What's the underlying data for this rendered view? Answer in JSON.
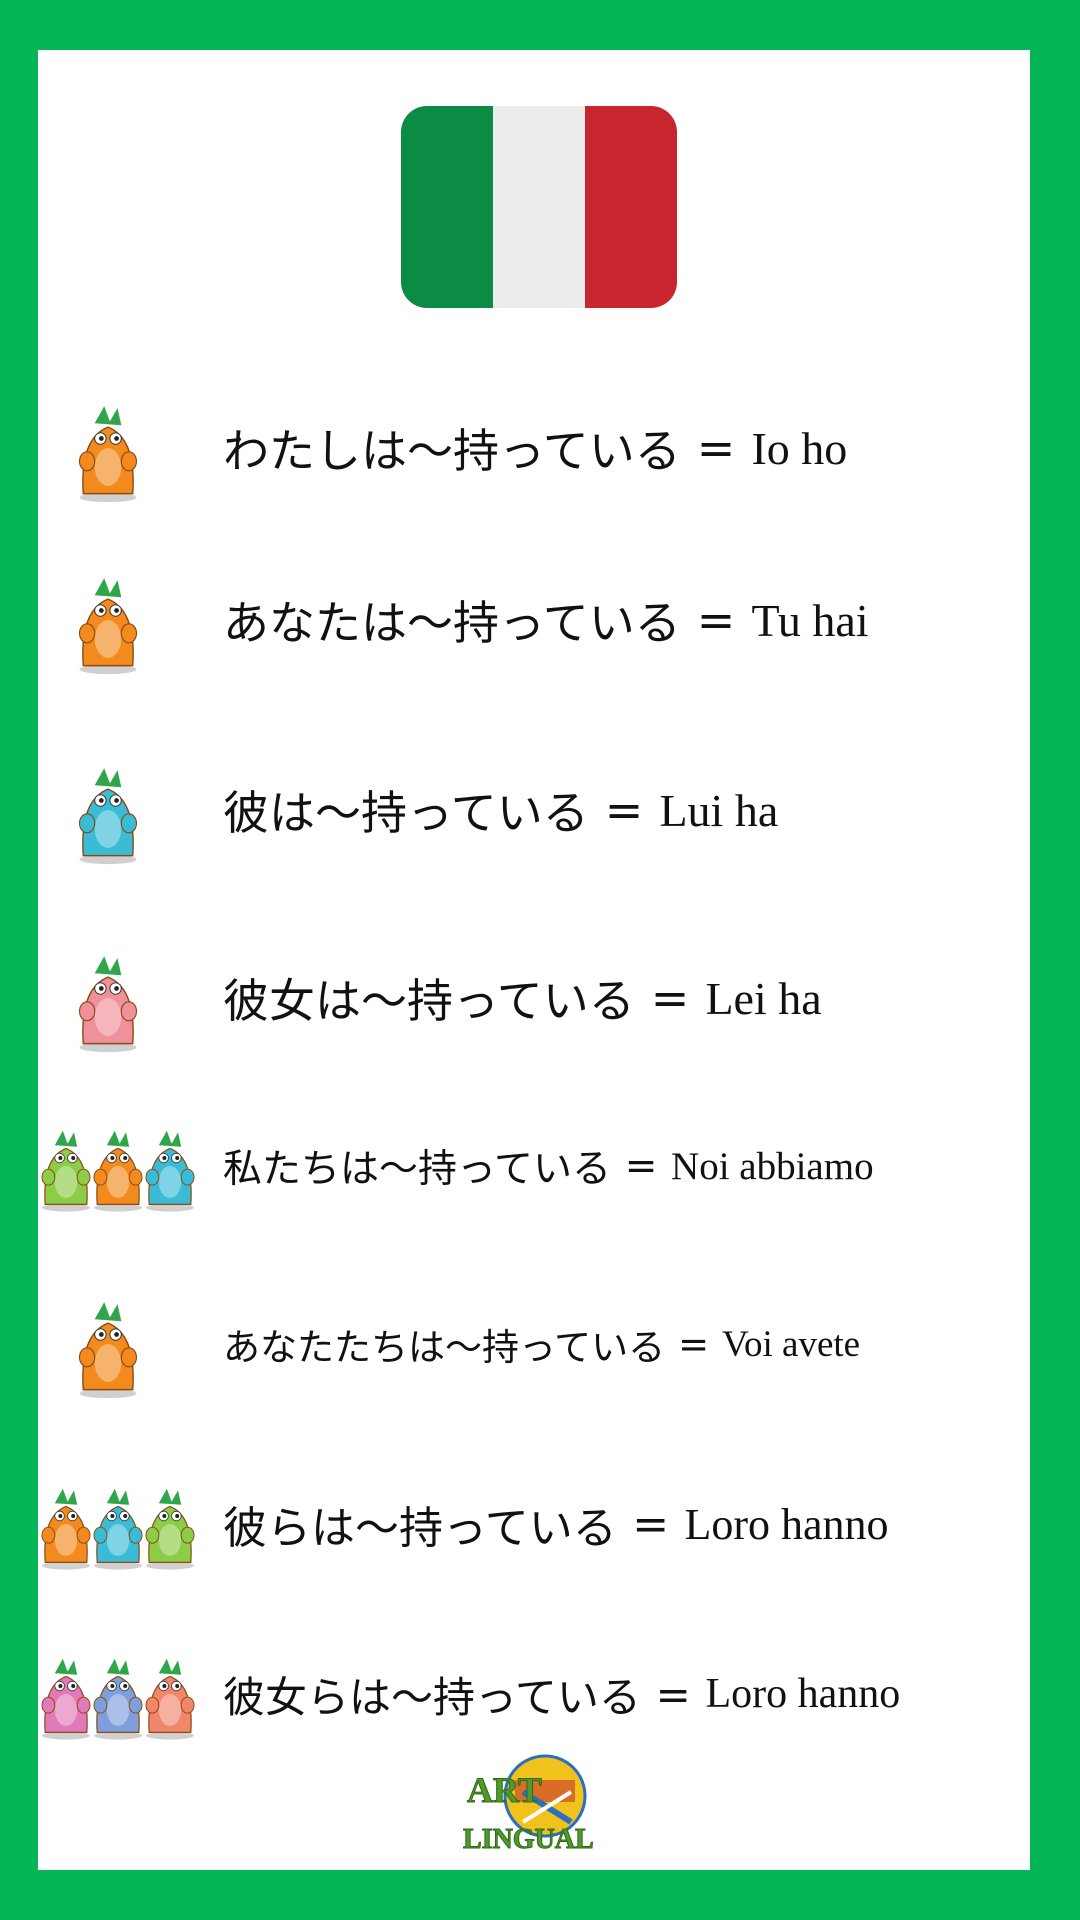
{
  "flag": {
    "name": "italy-flag",
    "colors": [
      "#0b8c44",
      "#ececec",
      "#c8262f"
    ]
  },
  "rows": [
    {
      "ja": "わたしは〜持っている",
      "eq": "=",
      "it": "Io ho",
      "characters": 1,
      "colors": [
        "#f28a1e"
      ]
    },
    {
      "ja": "あなたは〜持っている",
      "eq": "=",
      "it": "Tu hai",
      "characters": 1,
      "colors": [
        "#f28a1e"
      ]
    },
    {
      "ja": "彼は〜持っている",
      "eq": "=",
      "it": "Lui ha",
      "characters": 1,
      "colors": [
        "#3bbcd6"
      ]
    },
    {
      "ja": "彼女は〜持っている",
      "eq": "=",
      "it": "Lei ha",
      "characters": 1,
      "colors": [
        "#f0909a"
      ]
    },
    {
      "ja": "私たちは〜持っている",
      "eq": "=",
      "it": "Noi abbiamo",
      "characters": 3,
      "colors": [
        "#8ccc46",
        "#f28a1e",
        "#3bbcd6"
      ]
    },
    {
      "ja": "あなたたちは〜持っている",
      "eq": "=",
      "it": "Voi avete",
      "characters": 1,
      "colors": [
        "#f28a1e"
      ]
    },
    {
      "ja": "彼らは〜持っている",
      "eq": "=",
      "it": "Loro hanno",
      "characters": 3,
      "colors": [
        "#f28a1e",
        "#3bbcd6",
        "#8ccc46"
      ]
    },
    {
      "ja": "彼女らは〜持っている",
      "eq": "=",
      "it": "Loro hanno",
      "characters": 3,
      "colors": [
        "#e27ab8",
        "#7f9fdc",
        "#f2866a"
      ]
    }
  ],
  "logo": {
    "text_line1": "ART",
    "text_line2": "LINGUAL",
    "color": "#4f9a2a"
  }
}
